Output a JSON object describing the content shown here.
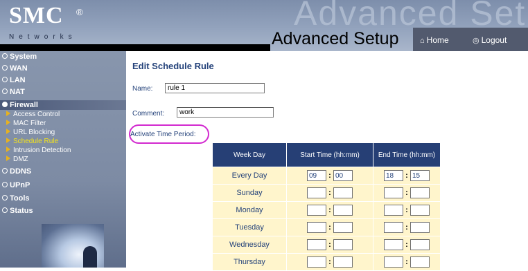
{
  "brand": {
    "logo": "SMC",
    "reg": "®",
    "sub": "Networks",
    "watermark": "Advanced Setup"
  },
  "header": {
    "title": "Advanced Setup",
    "home_label": "Home",
    "logout_label": "Logout",
    "home_icon": "home-icon",
    "logout_icon": "logout-icon"
  },
  "sidebar": {
    "items": [
      {
        "label": "System"
      },
      {
        "label": "WAN"
      },
      {
        "label": "LAN"
      },
      {
        "label": "NAT"
      },
      {
        "label": "Firewall"
      },
      {
        "label": "DDNS"
      },
      {
        "label": "UPnP"
      },
      {
        "label": "Tools"
      },
      {
        "label": "Status"
      }
    ],
    "firewall_sub": [
      {
        "label": "Access Control"
      },
      {
        "label": "MAC Filter"
      },
      {
        "label": "URL Blocking"
      },
      {
        "label": "Schedule Rule"
      },
      {
        "label": "Intrusion Detection"
      },
      {
        "label": "DMZ"
      }
    ]
  },
  "form": {
    "title": "Edit Schedule Rule",
    "name_label": "Name:",
    "name_value": "rule 1",
    "comment_label": "Comment:",
    "comment_value": "work",
    "period_label": "Activate Time Period:"
  },
  "table": {
    "headers": {
      "weekday": "Week Day",
      "start": "Start Time (hh:mm)",
      "end": "End Time (hh:mm)"
    },
    "colon": ":",
    "rows": [
      {
        "day": "Every Day",
        "sh": "09",
        "sm": "00",
        "eh": "18",
        "em": "15"
      },
      {
        "day": "Sunday",
        "sh": "",
        "sm": "",
        "eh": "",
        "em": ""
      },
      {
        "day": "Monday",
        "sh": "",
        "sm": "",
        "eh": "",
        "em": ""
      },
      {
        "day": "Tuesday",
        "sh": "",
        "sm": "",
        "eh": "",
        "em": ""
      },
      {
        "day": "Wednesday",
        "sh": "",
        "sm": "",
        "eh": "",
        "em": ""
      },
      {
        "day": "Thursday",
        "sh": "",
        "sm": "",
        "eh": "",
        "em": ""
      }
    ]
  },
  "colors": {
    "nav_blue": "#263f75",
    "row_bg": "#fff5cc",
    "highlight": "#d229cf",
    "sub_active": "#f5e41a"
  }
}
